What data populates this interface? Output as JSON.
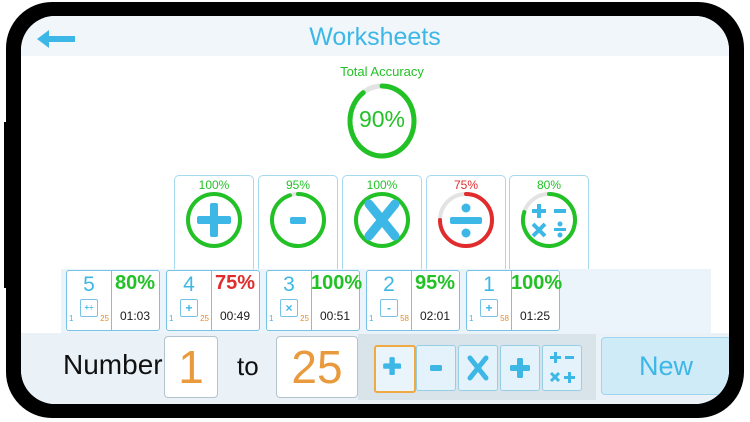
{
  "header": {
    "title": "Worksheets",
    "back_icon": "back-arrow-icon"
  },
  "total": {
    "label": "Total Accuracy",
    "value": "90%",
    "fraction": 0.9,
    "color": "#22c227"
  },
  "operations": [
    {
      "name": "addition",
      "icon": "plus-icon",
      "accuracy": "100%",
      "fraction": 1.0,
      "color": "#22c227"
    },
    {
      "name": "subtraction",
      "icon": "minus-icon",
      "accuracy": "95%",
      "fraction": 0.95,
      "color": "#22c227"
    },
    {
      "name": "multiplication",
      "icon": "times-icon",
      "accuracy": "100%",
      "fraction": 1.0,
      "color": "#22c227"
    },
    {
      "name": "division",
      "icon": "divide-icon",
      "accuracy": "75%",
      "fraction": 0.75,
      "color": "#e02c2c"
    },
    {
      "name": "mixed",
      "icon": "mixed-ops-icon",
      "accuracy": "80%",
      "fraction": 0.8,
      "color": "#22c227"
    }
  ],
  "worksheets": [
    {
      "count": "5",
      "icon_text": "+÷",
      "min": "1",
      "max": "25",
      "accuracy": "80%",
      "accuracy_color": "#22c227",
      "time": "01:03"
    },
    {
      "count": "4",
      "icon_text": "+",
      "min": "1",
      "max": "25",
      "accuracy": "75%",
      "accuracy_color": "#e02c2c",
      "time": "00:49"
    },
    {
      "count": "3",
      "icon_text": "×",
      "min": "1",
      "max": "25",
      "accuracy": "100%",
      "accuracy_color": "#22c227",
      "time": "00:51"
    },
    {
      "count": "2",
      "icon_text": "-",
      "min": "1",
      "max": "58",
      "accuracy": "95%",
      "accuracy_color": "#22c227",
      "time": "02:01"
    },
    {
      "count": "1",
      "icon_text": "+",
      "min": "1",
      "max": "58",
      "accuracy": "100%",
      "accuracy_color": "#22c227",
      "time": "01:25"
    }
  ],
  "range": {
    "number_label": "Number",
    "from": "1",
    "to_label": "to",
    "to": "25"
  },
  "op_buttons": [
    {
      "icon": "plus-icon",
      "selected": true
    },
    {
      "icon": "minus-icon",
      "selected": false
    },
    {
      "icon": "times-icon",
      "selected": false
    },
    {
      "icon": "plus-icon",
      "selected": false
    },
    {
      "icon": "mixed-ops-icon",
      "selected": false
    }
  ],
  "new_button": {
    "label": "New"
  },
  "colors": {
    "accent": "#3db7e6",
    "green": "#22c227",
    "red": "#e02c2c",
    "orange": "#e89a3c"
  }
}
